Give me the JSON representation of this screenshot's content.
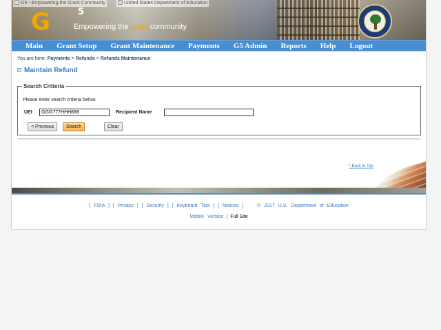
{
  "header": {
    "logo_alt": "G5 - Empowering the Grant Community",
    "ed_alt": "United States Department of Education",
    "logo_letter": "G",
    "logo_superscript": "5",
    "tagline_pre": "Empowering the ",
    "tagline_highlight": "grant",
    "tagline_post": " community"
  },
  "nav": {
    "items": [
      {
        "label": "Main"
      },
      {
        "label": "Grant Setup"
      },
      {
        "label": "Grant Maintenance"
      },
      {
        "label": "Payments"
      },
      {
        "label": "G5 Admin"
      },
      {
        "label": "Reports"
      },
      {
        "label": "Help"
      },
      {
        "label": "Logout"
      }
    ]
  },
  "breadcrumb": {
    "prefix": "You are here:",
    "items": [
      "Payments",
      "Refunds",
      "Refunds Maintenance"
    ],
    "separator": ">"
  },
  "page": {
    "title": "Maintain Refund"
  },
  "search": {
    "legend": "Search Critieria",
    "instructions": "Please enter search criteria below.",
    "uei_label": "UEI",
    "uei_value": "GGG777HHH888",
    "recipient_label": "Recipient Name",
    "recipient_value": "",
    "previous_label": "< Previous",
    "search_label": "Search",
    "clear_label": "Clear"
  },
  "back_to_top": "^ Back to Top",
  "footer": {
    "links": [
      "FOIA",
      "Privacy",
      "Security",
      "Keyboard Tips",
      "Notices"
    ],
    "copyright": "© 2017 U.S. Department of Education",
    "mobile": "Mobile Version",
    "full": "Full",
    "site": "Site"
  },
  "colors": {
    "nav_bg": "#4a8ed2",
    "title": "#3a7ac0",
    "accent": "#f2a600"
  }
}
